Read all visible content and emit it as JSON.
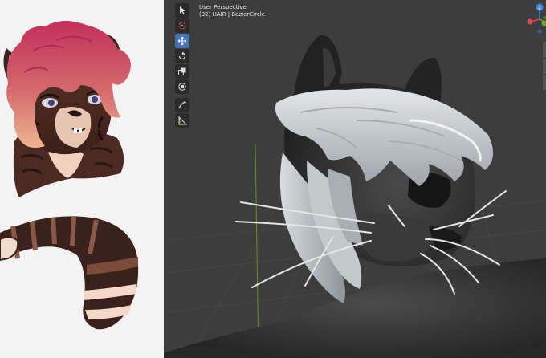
{
  "viewport": {
    "view_name": "User Perspective",
    "object_info": "(32) HAIR | BezierCircle"
  },
  "toolbar": {
    "tools": [
      {
        "name": "select-box-tool",
        "icon": "cursor-icon",
        "active": false
      },
      {
        "name": "cursor-tool",
        "icon": "3d-cursor-icon",
        "active": false
      },
      {
        "name": "move-tool",
        "icon": "move-arrows-icon",
        "active": true
      },
      {
        "name": "rotate-tool",
        "icon": "rotate-icon",
        "active": false
      },
      {
        "name": "scale-tool",
        "icon": "scale-icon",
        "active": false
      },
      {
        "name": "transform-tool",
        "icon": "transform-icon",
        "active": false
      },
      {
        "name": "annotate-tool",
        "icon": "annotate-pen-icon",
        "active": false
      },
      {
        "name": "measure-tool",
        "icon": "measure-ruler-icon",
        "active": false
      }
    ]
  },
  "gizmo": {
    "z_label": "Z",
    "x_color": "#e0454f",
    "y_color": "#6aa62c",
    "z_color": "#3f86f0"
  },
  "colors": {
    "viewport_bg": "#3d3d3d",
    "active_tool": "#4772b3",
    "model_dark": "#333333",
    "hair_light": "#cdd2d6",
    "whisker": "#e6e6e6",
    "grid_y_axis": "#6d8f1e",
    "reference_bg": "#f3f3f3"
  }
}
